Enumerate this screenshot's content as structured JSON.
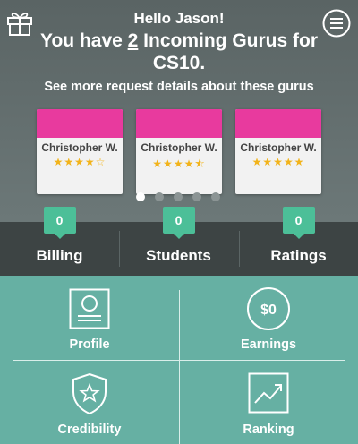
{
  "header": {
    "greeting": "Hello Jason!",
    "headline_prefix": "You have ",
    "incoming_count": "2",
    "headline_suffix": " Incoming Gurus for CS10.",
    "subline": "See more request details about these gurus",
    "gift_icon": "gift-icon",
    "menu_icon": "hamburger-menu-icon"
  },
  "gurus": [
    {
      "name": "Christopher W.",
      "stars": "★★★★☆",
      "rating": 4
    },
    {
      "name": "Christopher W.",
      "stars": "★★★★⯪",
      "rating": 4.5
    },
    {
      "name": "Christopher W.",
      "stars": "★★★★★",
      "rating": 5
    }
  ],
  "carousel": {
    "pages": 5,
    "active": 1
  },
  "stats": [
    {
      "label": "Billing",
      "count": "0"
    },
    {
      "label": "Students",
      "count": "0"
    },
    {
      "label": "Ratings",
      "count": "0"
    }
  ],
  "tiles": [
    {
      "label": "Profile",
      "icon": "profile-card-icon"
    },
    {
      "label": "Earnings",
      "icon": "dollar-coin-icon",
      "icon_text": "$0"
    },
    {
      "label": "Credibility",
      "icon": "shield-star-icon"
    },
    {
      "label": "Ranking",
      "icon": "trend-chart-icon"
    }
  ],
  "colors": {
    "accent_pink": "#e83a9e",
    "accent_green": "#4cbf98",
    "star": "#f2b31a",
    "grid_bg": "#66b0a3",
    "stats_bg": "#3d4444"
  }
}
